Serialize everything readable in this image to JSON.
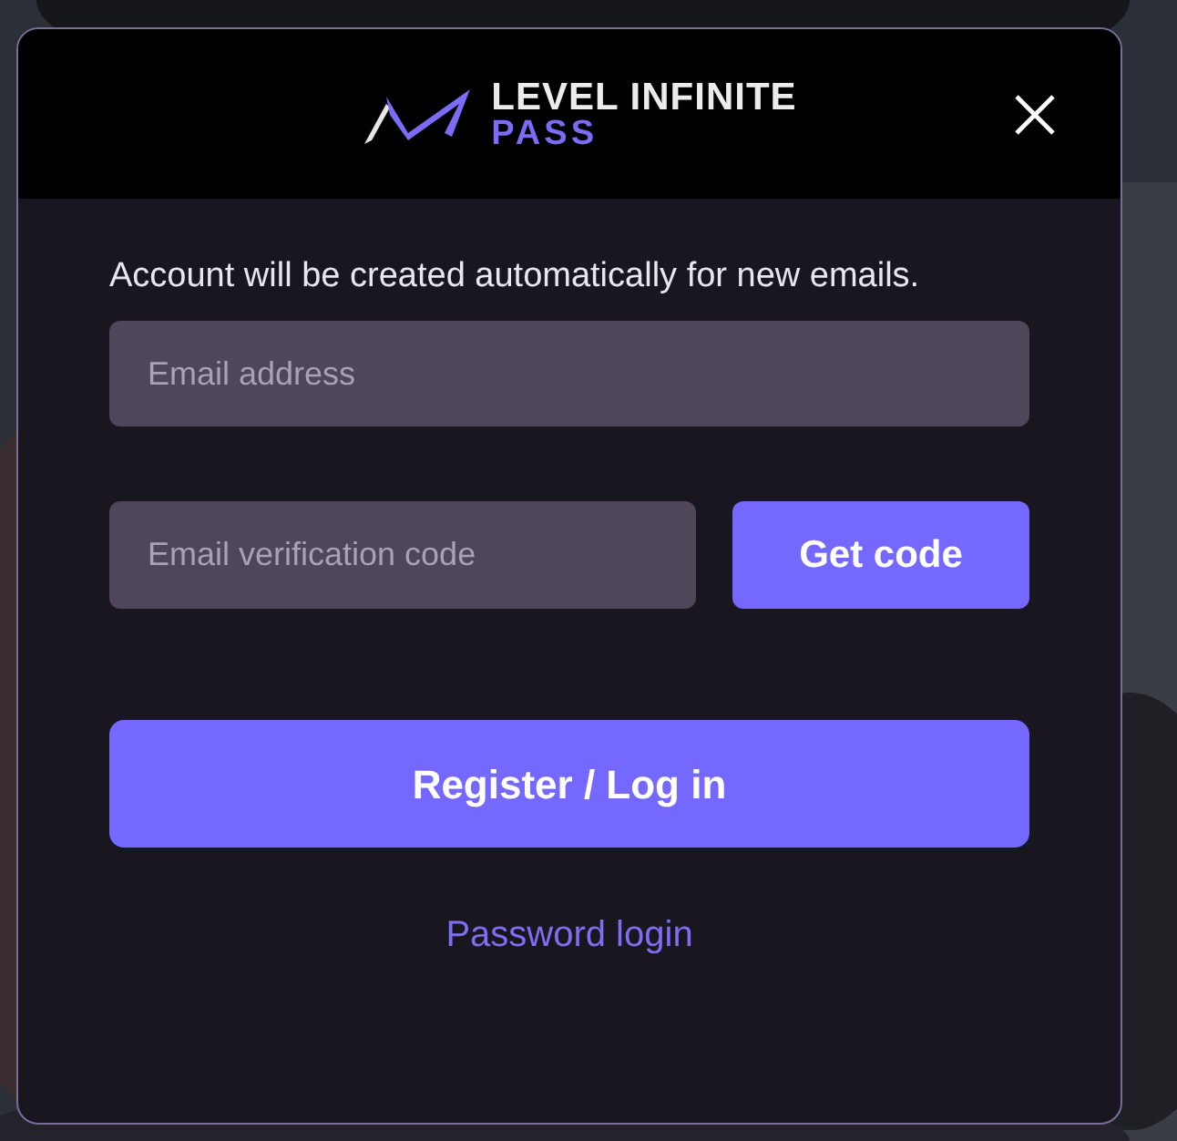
{
  "logo": {
    "line_1": "LEVEL INFINITE",
    "line_2": "PASS"
  },
  "notice": "Account will be created automatically for new emails.",
  "email_field": {
    "placeholder": "Email address"
  },
  "code_field": {
    "placeholder": "Email verification code"
  },
  "get_code_button": "Get code",
  "submit_button": "Register / Log in",
  "password_login_link": "Password login"
}
